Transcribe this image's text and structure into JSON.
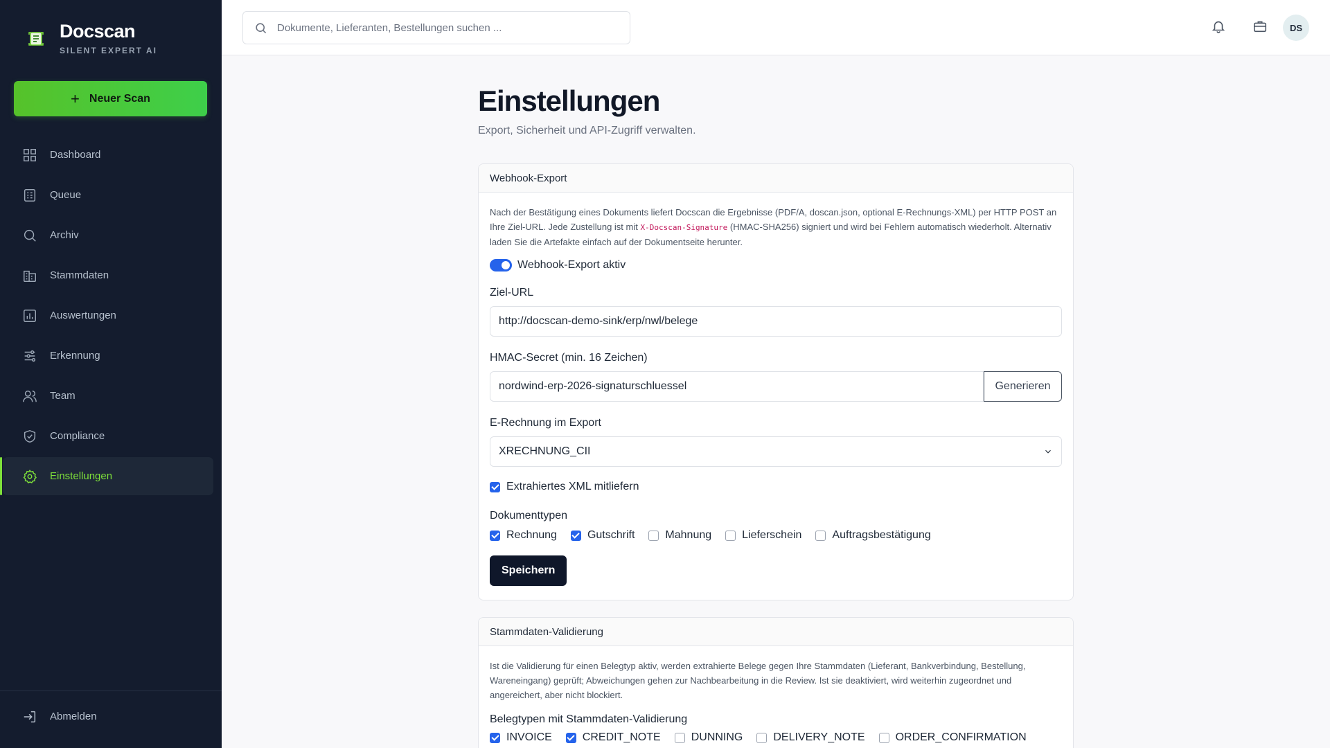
{
  "app": {
    "name": "Docscan",
    "tagline": "SILENT EXPERT AI",
    "accent_color": "#7ee03a",
    "new_scan_label": "Neuer Scan"
  },
  "sidebar": {
    "items": [
      {
        "label": "Dashboard",
        "icon": "dashboard-icon",
        "active": false
      },
      {
        "label": "Queue",
        "icon": "queue-icon",
        "active": false
      },
      {
        "label": "Archiv",
        "icon": "search-icon",
        "active": false
      },
      {
        "label": "Stammdaten",
        "icon": "building-icon",
        "active": false
      },
      {
        "label": "Auswertungen",
        "icon": "chart-icon",
        "active": false
      },
      {
        "label": "Erkennung",
        "icon": "sliders-icon",
        "active": false
      },
      {
        "label": "Team",
        "icon": "users-icon",
        "active": false
      },
      {
        "label": "Compliance",
        "icon": "shield-icon",
        "active": false
      },
      {
        "label": "Einstellungen",
        "icon": "gear-icon",
        "active": true
      }
    ],
    "logout_label": "Abmelden"
  },
  "topbar": {
    "search_placeholder": "Dokumente, Lieferanten, Bestellungen suchen ...",
    "avatar_initials": "DS"
  },
  "page": {
    "title": "Einstellungen",
    "subtitle": "Export, Sicherheit und API-Zugriff verwalten."
  },
  "webhook": {
    "header": "Webhook-Export",
    "desc_part1": "Nach der Bestätigung eines Dokuments liefert Docscan die Ergebnisse (PDF/A, doscan.json, optional E-Rechnungs-XML) per HTTP POST an Ihre Ziel-URL. Jede Zustellung ist mit ",
    "desc_code": "X-Docscan-Signature",
    "desc_part2": " (HMAC-SHA256) signiert und wird bei Fehlern automatisch wiederholt. Alternativ laden Sie die Artefakte einfach auf der Dokumentseite herunter.",
    "toggle_label": "Webhook-Export aktiv",
    "toggle_on": true,
    "url_label": "Ziel-URL",
    "url_value": "http://docscan-demo-sink/erp/nwl/belege",
    "secret_label": "HMAC-Secret (min. 16 Zeichen)",
    "secret_value": "nordwind-erp-2026-signaturschluessel",
    "generate_label": "Generieren",
    "erechnung_label": "E-Rechnung im Export",
    "erechnung_value": "XRECHNUNG_CII",
    "xml_label": "Extrahiertes XML mitliefern",
    "xml_checked": true,
    "doctypes_label": "Dokumenttypen",
    "doctypes": [
      {
        "label": "Rechnung",
        "checked": true
      },
      {
        "label": "Gutschrift",
        "checked": true
      },
      {
        "label": "Mahnung",
        "checked": false
      },
      {
        "label": "Lieferschein",
        "checked": false
      },
      {
        "label": "Auftragsbestätigung",
        "checked": false
      }
    ],
    "save_label": "Speichern"
  },
  "stammdaten": {
    "header": "Stammdaten-Validierung",
    "desc": "Ist die Validierung für einen Belegtyp aktiv, werden extrahierte Belege gegen Ihre Stammdaten (Lieferant, Bankverbindung, Bestellung, Wareneingang) geprüft; Abweichungen gehen zur Nachbearbeitung in die Review. Ist sie deaktiviert, wird weiterhin zugeordnet und angereichert, aber nicht blockiert.",
    "types_label": "Belegtypen mit Stammdaten-Validierung",
    "types": [
      {
        "label": "INVOICE",
        "checked": true
      },
      {
        "label": "CREDIT_NOTE",
        "checked": true
      },
      {
        "label": "DUNNING",
        "checked": false
      },
      {
        "label": "DELIVERY_NOTE",
        "checked": false
      },
      {
        "label": "ORDER_CONFIRMATION",
        "checked": false
      }
    ]
  }
}
